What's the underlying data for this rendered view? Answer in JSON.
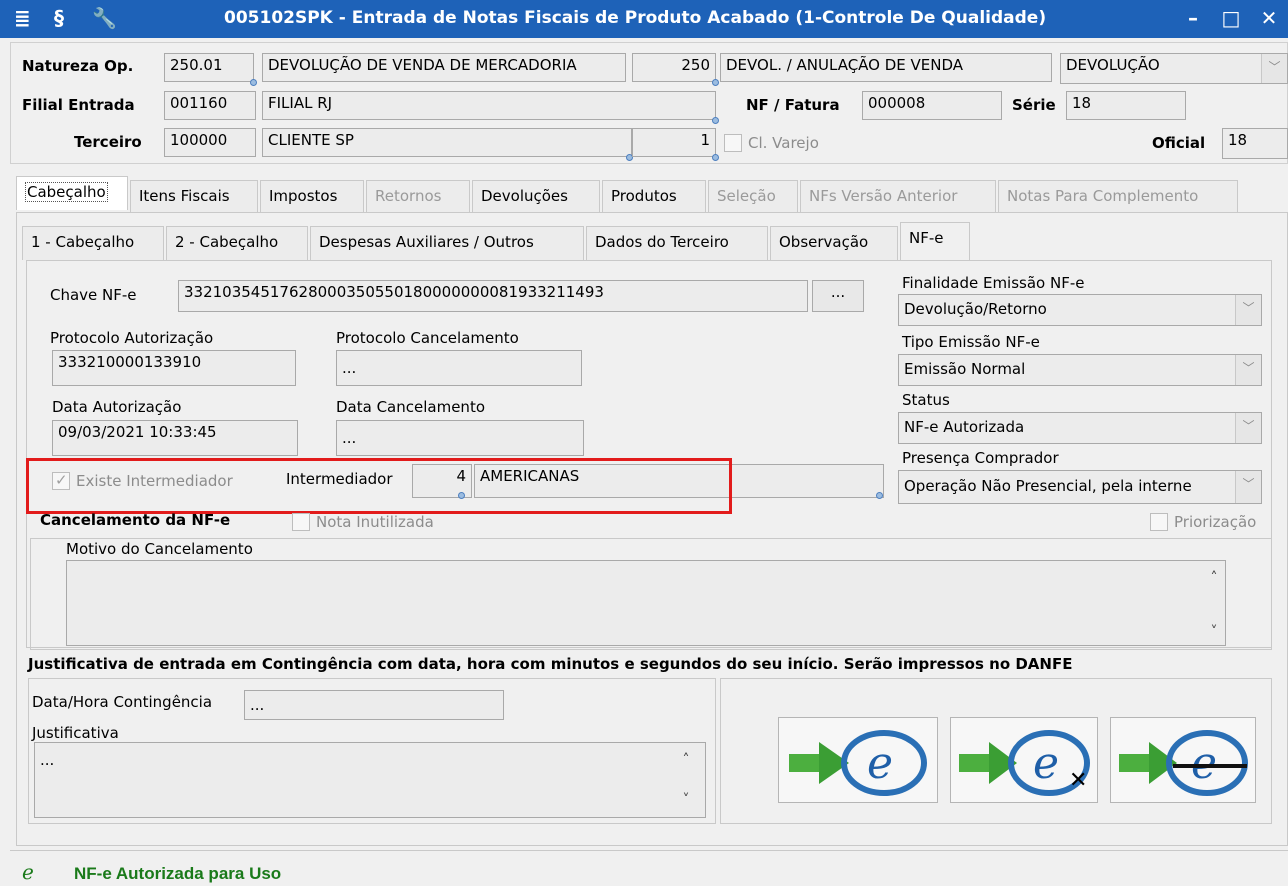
{
  "window": {
    "title": "005102SPK - Entrada de Notas Fiscais de Produto Acabado (1-Controle De Qualidade)",
    "minimize_label": "–",
    "maximize_label": "□",
    "close_label": "✕"
  },
  "header": {
    "natureza_label": "Natureza Op.",
    "natureza_code": "250.01",
    "natureza_desc": "DEVOLUÇÃO DE VENDA DE MERCADORIA",
    "natureza_num": "250",
    "natureza_desc2": "DEVOL. / ANULAÇÃO DE VENDA",
    "natureza_type": "DEVOLUÇÃO",
    "filial_label": "Filial Entrada",
    "filial_code": "001160",
    "filial_name": "FILIAL RJ",
    "nf_label": "NF / Fatura",
    "nf_value": "000008",
    "serie_label": "Série",
    "serie_value": "18",
    "terceiro_label": "Terceiro",
    "terceiro_code": "100000",
    "terceiro_name": "CLIENTE SP",
    "terceiro_num": "1",
    "cl_varejo_label": "Cl. Varejo",
    "oficial_label": "Oficial",
    "oficial_value": "18"
  },
  "main_tabs": [
    {
      "label": "Cabeçalho",
      "state": "active"
    },
    {
      "label": "Itens Fiscais",
      "state": "normal"
    },
    {
      "label": "Impostos",
      "state": "normal"
    },
    {
      "label": "Retornos",
      "state": "disabled"
    },
    {
      "label": "Devoluções",
      "state": "normal"
    },
    {
      "label": "Produtos",
      "state": "normal"
    },
    {
      "label": "Seleção",
      "state": "disabled"
    },
    {
      "label": "NFs Versão Anterior",
      "state": "disabled"
    },
    {
      "label": "Notas Para Complemento",
      "state": "disabled"
    }
  ],
  "sub_tabs": [
    {
      "label": "1 - Cabeçalho",
      "state": "normal"
    },
    {
      "label": "2 - Cabeçalho",
      "state": "normal"
    },
    {
      "label": "Despesas Auxiliares / Outros",
      "state": "normal"
    },
    {
      "label": "Dados do Terceiro",
      "state": "normal"
    },
    {
      "label": "Observação",
      "state": "normal"
    },
    {
      "label": "NF-e",
      "state": "active"
    }
  ],
  "nfe": {
    "chave_label": "Chave NF-e",
    "chave_value": "33210354517628000350550180000000081933211493",
    "ellipsis_button": "...",
    "protocolo_aut_label": "Protocolo Autorização",
    "protocolo_aut_value": "333210000133910",
    "protocolo_canc_label": "Protocolo Cancelamento",
    "protocolo_canc_value": "...",
    "data_aut_label": "Data Autorização",
    "data_aut_value": "09/03/2021 10:33:45",
    "data_canc_label": "Data Cancelamento",
    "data_canc_value": "...",
    "existe_intermediador_label": "Existe Intermediador",
    "intermediador_label": "Intermediador",
    "intermediador_code": "4",
    "intermediador_name": "AMERICANAS",
    "finalidade_label": "Finalidade Emissão NF-e",
    "finalidade_value": "Devolução/Retorno",
    "tipo_emissao_label": "Tipo Emissão NF-e",
    "tipo_emissao_value": "Emissão Normal",
    "status_label": "Status",
    "status_value": "NF-e Autorizada",
    "presenca_label": "Presença Comprador",
    "presenca_value": "Operação Não Presencial, pela interne"
  },
  "cancel": {
    "title": "Cancelamento da NF-e",
    "nota_inutilizada_label": "Nota Inutilizada",
    "priorizacao_label": "Priorização",
    "motivo_label": "Motivo do Cancelamento",
    "scroll_up": "˄",
    "scroll_down": "˅"
  },
  "contingencia": {
    "title": "Justificativa de entrada em Contingência com data, hora com minutos e segundos do seu início. Serão impressos no DANFE",
    "data_hora_label": "Data/Hora Contingência",
    "data_hora_value": "...",
    "justificativa_label": "Justificativa",
    "justificativa_value": "..."
  },
  "nfe_buttons": [
    {
      "name": "nfe-send",
      "overlay": ""
    },
    {
      "name": "nfe-cancel",
      "overlay": "✕"
    },
    {
      "name": "nfe-inutilize",
      "overlay": "—"
    }
  ],
  "status_bar": {
    "message": "NF-e Autorizada para Uso"
  },
  "colors": {
    "titlebar": "#1e62b8",
    "highlight_box": "#e21b1b",
    "status_text": "#1a7a1a"
  }
}
